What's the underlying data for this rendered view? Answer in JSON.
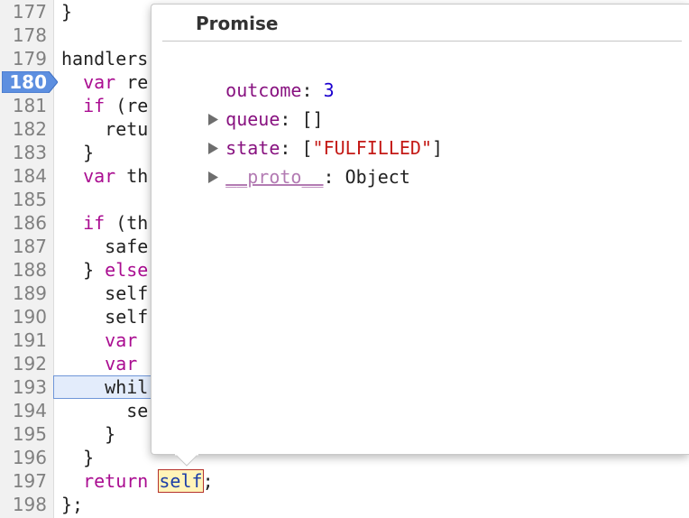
{
  "editor": {
    "lines": [
      {
        "num": "177",
        "text": "}"
      },
      {
        "num": "178",
        "text": ""
      },
      {
        "num": "179",
        "text": "handlers"
      },
      {
        "num": "180",
        "text": "  var re",
        "breakpoint": true
      },
      {
        "num": "181",
        "text": "  if (re"
      },
      {
        "num": "182",
        "text": "    retu"
      },
      {
        "num": "183",
        "text": "  }"
      },
      {
        "num": "184",
        "text": "  var th"
      },
      {
        "num": "185",
        "text": ""
      },
      {
        "num": "186",
        "text": "  if (th"
      },
      {
        "num": "187",
        "text": "    safe"
      },
      {
        "num": "188",
        "text": "  } else"
      },
      {
        "num": "189",
        "text": "    self"
      },
      {
        "num": "190",
        "text": "    self"
      },
      {
        "num": "191",
        "text": "    var "
      },
      {
        "num": "192",
        "text": "    var "
      },
      {
        "num": "193",
        "text": "    whil",
        "current": true
      },
      {
        "num": "194",
        "text": "      se"
      },
      {
        "num": "195",
        "text": "    }"
      },
      {
        "num": "196",
        "text": "  }"
      },
      {
        "num": "197",
        "text": "  return self;"
      },
      {
        "num": "198",
        "text": "};"
      }
    ],
    "highlighted_token": "self",
    "colors": {
      "keyword": "#aa0d91",
      "breakpoint": "#5d8fe0",
      "current_line": "#e3ecfb"
    }
  },
  "popover": {
    "title": "Promise",
    "properties": [
      {
        "name": "outcome",
        "value": "3",
        "value_type": "number",
        "expandable": false
      },
      {
        "name": "queue",
        "value": "[]",
        "value_type": "plain",
        "expandable": true
      },
      {
        "name": "state",
        "value_prefix": "[",
        "value": "\"FULFILLED\"",
        "value_suffix": "]",
        "value_type": "string",
        "expandable": true
      },
      {
        "name": "__proto__",
        "value": "Object",
        "value_type": "plain",
        "expandable": true,
        "dim": true
      }
    ]
  }
}
